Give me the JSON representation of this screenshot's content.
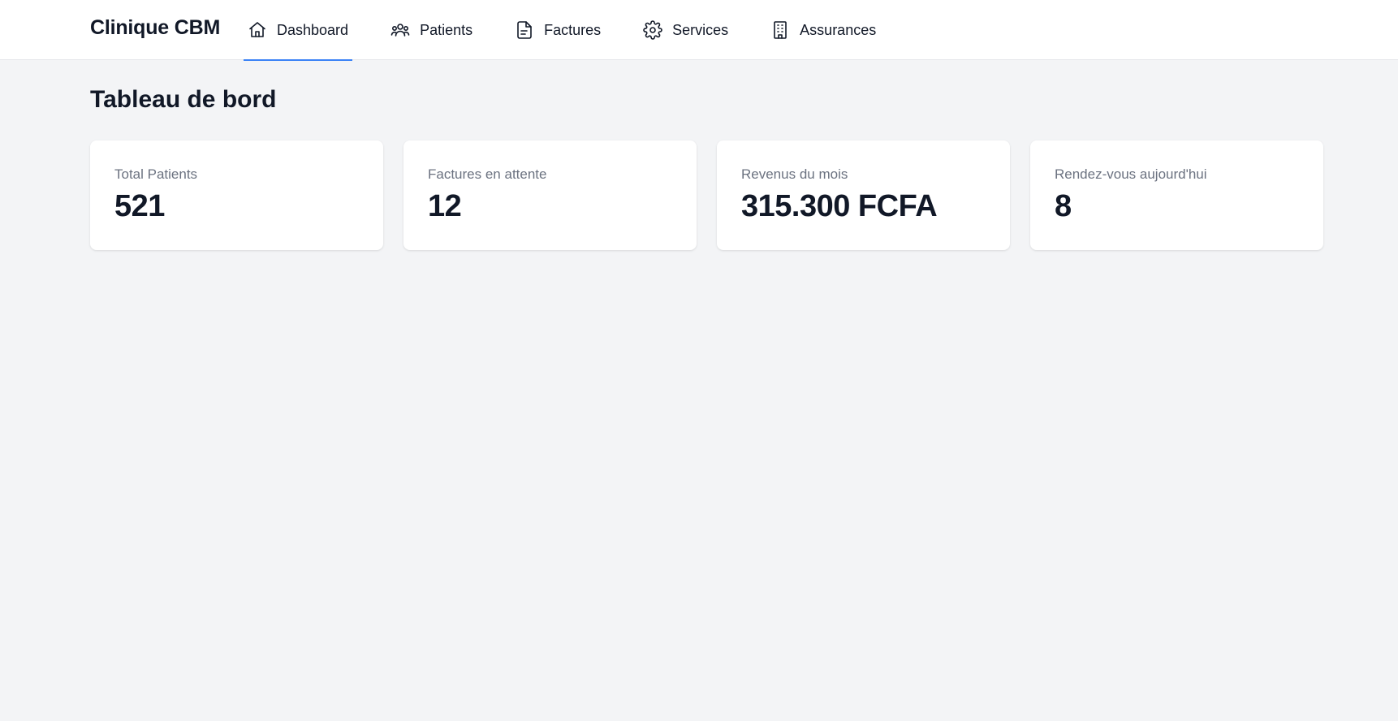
{
  "app": {
    "brand": "Clinique CBM"
  },
  "nav": {
    "items": [
      {
        "label": "Dashboard",
        "icon": "home-icon",
        "active": true
      },
      {
        "label": "Patients",
        "icon": "users-icon",
        "active": false
      },
      {
        "label": "Factures",
        "icon": "file-text-icon",
        "active": false
      },
      {
        "label": "Services",
        "icon": "gear-icon",
        "active": false
      },
      {
        "label": "Assurances",
        "icon": "building-icon",
        "active": false
      }
    ]
  },
  "page": {
    "title": "Tableau de bord"
  },
  "stats": [
    {
      "label": "Total Patients",
      "value": "521"
    },
    {
      "label": "Factures en attente",
      "value": "12"
    },
    {
      "label": "Revenus du mois",
      "value": "315.300 FCFA"
    },
    {
      "label": "Rendez-vous aujourd'hui",
      "value": "8"
    }
  ],
  "colors": {
    "accent": "#3b82f6",
    "background": "#f3f4f6",
    "card": "#ffffff",
    "muted_text": "#6b7280"
  }
}
